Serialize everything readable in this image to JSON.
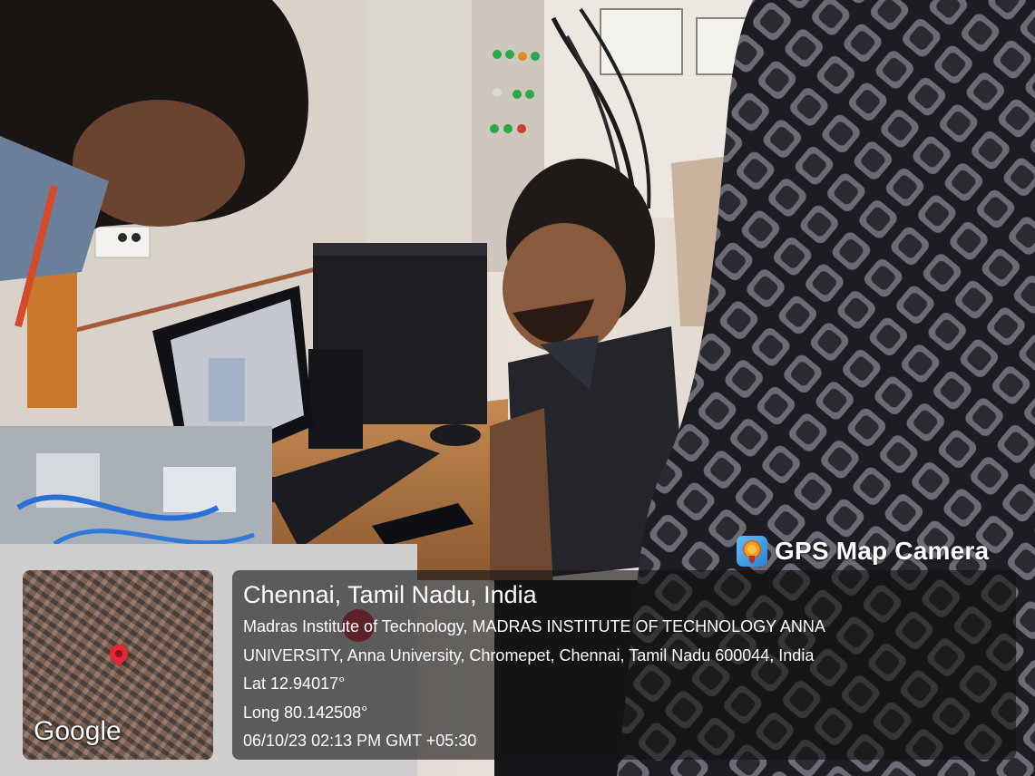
{
  "overlay": {
    "app_badge": "GPS Map Camera",
    "map_logo": "Google",
    "location_title": "Chennai, Tamil Nadu, India",
    "address_line_1": "Madras Institute of Technology, MADRAS INSTITUTE OF TECHNOLOGY ANNA",
    "address_line_2": "UNIVERSITY, Anna University, Chromepet, Chennai, Tamil Nadu 600044, India",
    "latitude": "Lat 12.94017°",
    "longitude": "Long 80.142508°",
    "timestamp": "06/10/23 02:13 PM GMT +05:30"
  }
}
